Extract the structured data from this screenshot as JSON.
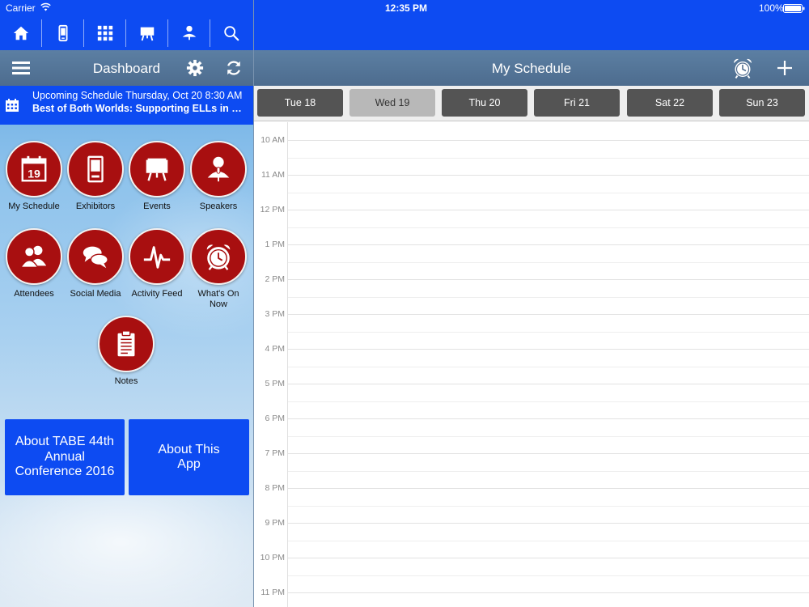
{
  "status": {
    "carrier": "Carrier",
    "time": "12:35 PM",
    "battery": "100%"
  },
  "toolbar": {
    "items": [
      {
        "icon": "home-icon"
      },
      {
        "icon": "device-icon"
      },
      {
        "icon": "grid-icon"
      },
      {
        "icon": "presentation-icon"
      },
      {
        "icon": "speaker-icon"
      },
      {
        "icon": "search-icon"
      }
    ]
  },
  "dashboard": {
    "title": "Dashboard"
  },
  "upcoming": {
    "line1": "Upcoming Schedule Thursday, Oct 20 8:30 AM",
    "line2": "Best of Both Worlds: Supporting ELLs in Language and Content"
  },
  "tiles": [
    {
      "label": "My Schedule",
      "icon": "calendar-icon",
      "calendar_day": "19"
    },
    {
      "label": "Exhibitors",
      "icon": "booth-icon"
    },
    {
      "label": "Events",
      "icon": "easel-icon"
    },
    {
      "label": "Speakers",
      "icon": "microphone-person-icon"
    },
    {
      "label": "Attendees",
      "icon": "people-icon"
    },
    {
      "label": "Social Media",
      "icon": "chat-bubbles-icon"
    },
    {
      "label": "Activity Feed",
      "icon": "pulse-icon"
    },
    {
      "label": "What's On Now",
      "icon": "alarm-clock-icon"
    },
    {
      "label": "Notes",
      "icon": "clipboard-icon"
    }
  ],
  "about": {
    "conference": "About TABE 44th Annual Conference 2016",
    "app": "About This App"
  },
  "schedule": {
    "title": "My Schedule",
    "days": [
      "Tue 18",
      "Wed 19",
      "Thu 20",
      "Fri 21",
      "Sat 22",
      "Sun 23"
    ],
    "selected_day": "Wed 19",
    "hours": [
      "10 AM",
      "11 AM",
      "12 PM",
      "1 PM",
      "2 PM",
      "3 PM",
      "4 PM",
      "5 PM",
      "6 PM",
      "7 PM",
      "8 PM",
      "9 PM",
      "10 PM",
      "11 PM"
    ]
  },
  "colors": {
    "brand_blue": "#0d4bf2",
    "tile_red": "#a80f10",
    "header_slate": "#546f90"
  }
}
